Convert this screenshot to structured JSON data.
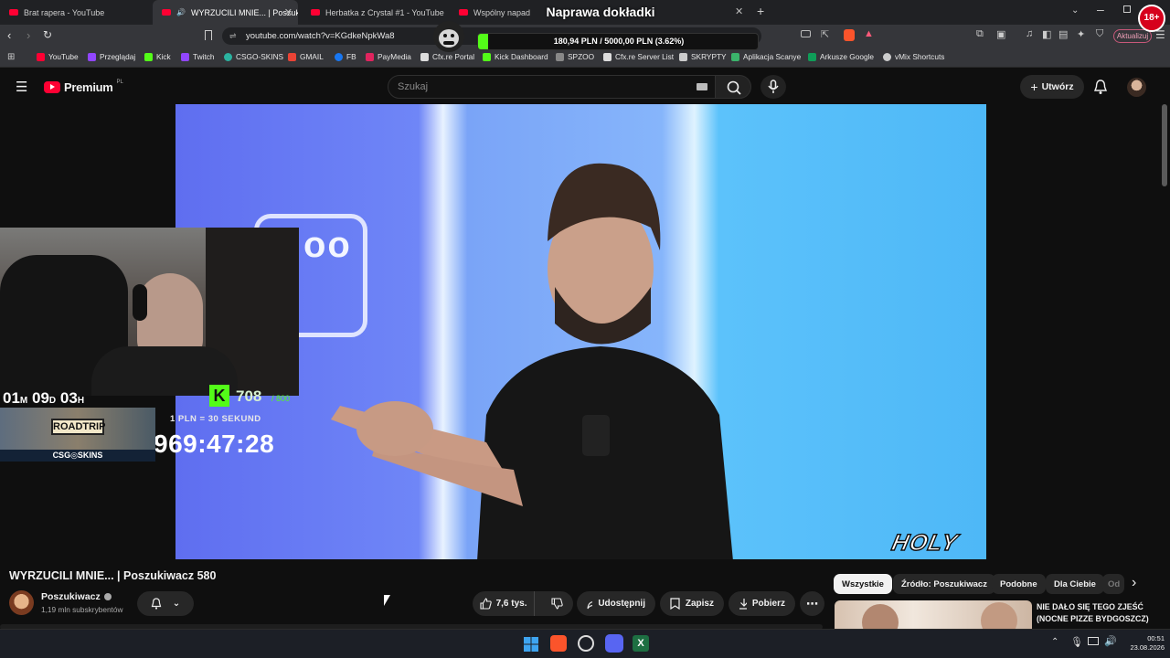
{
  "browser": {
    "tabs": [
      {
        "label": "Brat rapera - YouTube",
        "active": false
      },
      {
        "label": "WYRZUCILI MNIE... | Poszukiw",
        "active": true
      },
      {
        "label": "Herbatka z Crystal #1 - YouTube",
        "active": false
      },
      {
        "label": "Wspólny napad z C",
        "active": false
      }
    ],
    "url": "youtube.com/watch?v=KGdkeNpkWa8",
    "update_label": "Aktualizuj",
    "bookmarks": [
      "YouTube",
      "Przeglądaj",
      "Kick",
      "Twitch",
      "CSGO-SKINS",
      "GMAIL",
      "FB",
      "PayMedia",
      "Cfx.re Portal",
      "Kick Dashboard",
      "SPZOO",
      "Cfx.re Server List",
      "SKRYPTY",
      "Aplikacja Scanye",
      "Arkusze Google",
      "vMix Shortcuts"
    ]
  },
  "stream_overlay": {
    "goal_title": "Naprawa dokładki",
    "goal_progress": "180,94 PLN / 5000,00 PLN  (3.62%)",
    "goal_fraction": 0.0362,
    "age_badge": "18+",
    "countdown": {
      "months": "01",
      "m": "M",
      "days": "09",
      "d": "D",
      "hours": "03",
      "h": "H"
    },
    "kick_count": "708",
    "kick_goal": "/ 800",
    "rate_label": "1 PLN = 30 SEKUND",
    "timer": "969:47:28",
    "roadtrip": "ROADTRIP",
    "sponsor": "CSG◎SKINS"
  },
  "youtube": {
    "premium_label": "Premium",
    "premium_region": "PL",
    "search_placeholder": "Szukaj",
    "create_label": "Utwórz",
    "video_title": "WYRZUCILI MNIE... | Poszukiwacz 580",
    "channel_name": "Poszukiwacz",
    "subscribers": "1,19 mln subskrybentów",
    "likes": "7,6 tys.",
    "share_label": "Udostępnij",
    "save_label": "Zapisz",
    "download_label": "Pobierz",
    "watermark": "HOLY",
    "logo_fragment": "oo",
    "chips": [
      "Wszystkie",
      "Źródło: Poszukiwacz",
      "Podobne",
      "Dla Ciebie",
      "Od"
    ],
    "recommendation_title": "NIE DAŁO SIĘ TEGO ZJEŚĆ (NOCNE PIZZE BYDGOSZCZ)"
  },
  "system": {
    "time": "00:51",
    "date": "23.08.2026"
  },
  "colors": {
    "youtube_red": "#ff0033",
    "kick_green": "#53fc18",
    "page_bg": "#0f0f0f"
  }
}
